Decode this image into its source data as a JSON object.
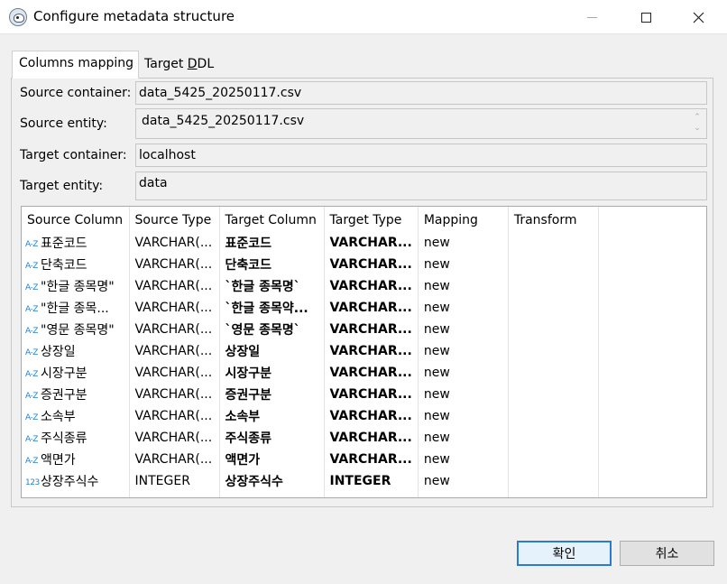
{
  "window": {
    "title": "Configure metadata structure",
    "minimize_icon": "minimize-icon",
    "maximize_icon": "maximize-icon",
    "close_icon": "close-icon"
  },
  "tabs": [
    {
      "label": "Columns mapping",
      "active": true
    },
    {
      "label_pre": "Target ",
      "label_mnemonic": "D",
      "label_post": "DL",
      "active": false
    }
  ],
  "fields": {
    "source_container": {
      "label": "Source container:",
      "value": "data_5425_20250117.csv"
    },
    "source_entity": {
      "label": "Source entity:",
      "value": "data_5425_20250117.csv"
    },
    "target_container": {
      "label": "Target container:",
      "value": "localhost"
    },
    "target_entity": {
      "label": "Target entity:",
      "value": "data"
    }
  },
  "grid": {
    "columns": [
      "Source Column",
      "Source Type",
      "Target Column",
      "Target Type",
      "Mapping",
      "Transform"
    ],
    "rows": [
      {
        "icon": "A-Z",
        "source_column": "표준코드",
        "source_type": "VARCHAR(...",
        "target_column": "표준코드",
        "target_type": "VARCHAR...",
        "mapping": "new",
        "transform": ""
      },
      {
        "icon": "A-Z",
        "source_column": "단축코드",
        "source_type": "VARCHAR(...",
        "target_column": "단축코드",
        "target_type": "VARCHAR...",
        "mapping": "new",
        "transform": ""
      },
      {
        "icon": "A-Z",
        "source_column": "\"한글 종목명\"",
        "source_type": "VARCHAR(...",
        "target_column": "`한글 종목명`",
        "target_type": "VARCHAR...",
        "mapping": "new",
        "transform": ""
      },
      {
        "icon": "A-Z",
        "source_column": "\"한글 종목...",
        "source_type": "VARCHAR(...",
        "target_column": "`한글 종목약...",
        "target_type": "VARCHAR...",
        "mapping": "new",
        "transform": ""
      },
      {
        "icon": "A-Z",
        "source_column": "\"영문 종목명\"",
        "source_type": "VARCHAR(...",
        "target_column": "`영문 종목명`",
        "target_type": "VARCHAR...",
        "mapping": "new",
        "transform": ""
      },
      {
        "icon": "A-Z",
        "source_column": "상장일",
        "source_type": "VARCHAR(...",
        "target_column": "상장일",
        "target_type": "VARCHAR...",
        "mapping": "new",
        "transform": ""
      },
      {
        "icon": "A-Z",
        "source_column": "시장구분",
        "source_type": "VARCHAR(...",
        "target_column": "시장구분",
        "target_type": "VARCHAR...",
        "mapping": "new",
        "transform": ""
      },
      {
        "icon": "A-Z",
        "source_column": "증권구분",
        "source_type": "VARCHAR(...",
        "target_column": "증권구분",
        "target_type": "VARCHAR...",
        "mapping": "new",
        "transform": ""
      },
      {
        "icon": "A-Z",
        "source_column": "소속부",
        "source_type": "VARCHAR(...",
        "target_column": "소속부",
        "target_type": "VARCHAR...",
        "mapping": "new",
        "transform": ""
      },
      {
        "icon": "A-Z",
        "source_column": "주식종류",
        "source_type": "VARCHAR(...",
        "target_column": "주식종류",
        "target_type": "VARCHAR...",
        "mapping": "new",
        "transform": ""
      },
      {
        "icon": "A-Z",
        "source_column": "액면가",
        "source_type": "VARCHAR(...",
        "target_column": "액면가",
        "target_type": "VARCHAR...",
        "mapping": "new",
        "transform": ""
      },
      {
        "icon": "123",
        "source_column": "상장주식수",
        "source_type": "INTEGER",
        "target_column": "상장주식수",
        "target_type": "INTEGER",
        "mapping": "new",
        "transform": ""
      }
    ]
  },
  "buttons": {
    "ok": "확인",
    "cancel": "취소"
  },
  "colors": {
    "accent": "#2a7ad6",
    "type_icon": "#2a7fc0"
  }
}
